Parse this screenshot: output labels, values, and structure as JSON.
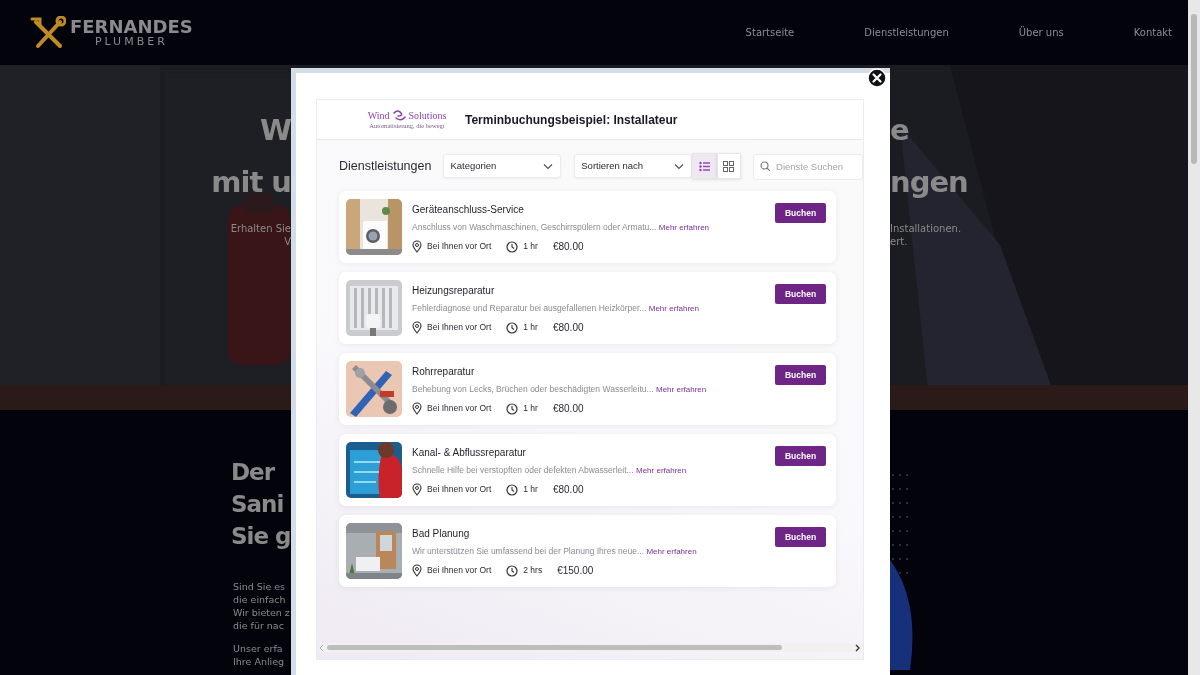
{
  "site": {
    "logo": {
      "title": "FERNANDES",
      "subtitle": "PLUMBER"
    },
    "nav": [
      {
        "label": "Startseite"
      },
      {
        "label": "Dienstleistungen"
      },
      {
        "label": "Über uns"
      },
      {
        "label": "Kontakt"
      }
    ],
    "hero": {
      "lines": [
        {
          "kind": "heading",
          "left": "W",
          "right": "e"
        },
        {
          "kind": "heading",
          "left": "mit u",
          "right": "ngen"
        },
        {
          "kind": "body",
          "left": "Erhalten Sie",
          "right": "Installationen."
        },
        {
          "kind": "body",
          "left": "V",
          "right": "ert."
        }
      ]
    },
    "about": {
      "heading_lines": [
        "Der",
        "Sani",
        "Sie g"
      ],
      "paragraphs": [
        [
          "Sind Sie es",
          "die einfach",
          "Wir bieten z",
          "die für nac"
        ],
        [
          "Unser erfa",
          "Ihre Anlieg"
        ]
      ]
    }
  },
  "modal": {
    "brand": {
      "left": "Wind",
      "right": "Solutions",
      "tagline": "Automatisierung, die bewegt"
    },
    "title": "Terminbuchungsbeispiel: Installateur",
    "section_label": "Dienstleistungen",
    "filters": [
      {
        "label": "Kategorien"
      },
      {
        "label": "Sortieren nach"
      }
    ],
    "views": [
      {
        "kind": "list",
        "selected": true
      },
      {
        "kind": "grid",
        "selected": false
      }
    ],
    "search": {
      "placeholder": "Dienste Suchen"
    },
    "services": [
      {
        "kind": "washer",
        "title": "Geräteanschluss-Service",
        "description": "Anschluss von Waschmaschinen, Geschirrspülern oder Armatu...",
        "link": "Mehr erfahren",
        "location": "Bei Ihnen vor Ort",
        "duration": "1 hr",
        "price": "€80.00",
        "button": "Buchen"
      },
      {
        "kind": "radiator",
        "title": "Heizungsreparatur",
        "description": "Fehlerdiagnose und Reparatur bei ausgefallenen Heizkörper...",
        "link": "Mehr erfahren",
        "location": "Bei Ihnen vor Ort",
        "duration": "1 hr",
        "price": "€80.00",
        "button": "Buchen"
      },
      {
        "kind": "tools",
        "title": "Rohrreparatur",
        "description": "Behebung von Lecks, Brüchen oder beschädigten Wasserleitu...",
        "link": "Mehr erfahren",
        "location": "Bei Ihnen vor Ort",
        "duration": "1 hr",
        "price": "€80.00",
        "button": "Buchen"
      },
      {
        "kind": "drain",
        "title": "Kanal- & Abflussreparatur",
        "description": "Schnelle Hilfe bei verstopften oder defekten Abwasserleit...",
        "link": "Mehr erfahren",
        "location": "Bei Ihnen vor Ort",
        "duration": "1 hr",
        "price": "€80.00",
        "button": "Buchen"
      },
      {
        "kind": "bathroom",
        "title": "Bad Planung",
        "description": "Wir unterstützen Sie umfassend bei der Planung Ihres neue...",
        "link": "Mehr erfahren",
        "location": "Bei Ihnen vor Ort",
        "duration": "2 hrs",
        "price": "€150.00",
        "button": "Buchen"
      }
    ]
  }
}
